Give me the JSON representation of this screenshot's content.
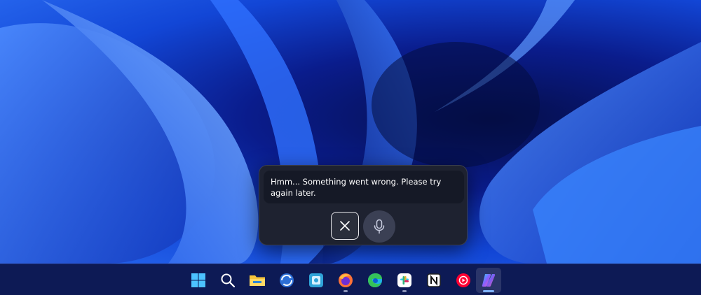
{
  "voice_panel": {
    "message": "Hmm... Something went wrong. Please try again later.",
    "dismiss_icon": "close-icon",
    "mic_icon": "microphone-icon"
  },
  "taskbar": {
    "items": [
      {
        "name": "start",
        "icon": "windows-logo-icon",
        "running": false,
        "active": false
      },
      {
        "name": "search",
        "icon": "search-icon",
        "running": false,
        "active": false
      },
      {
        "name": "file-explorer",
        "icon": "folder-icon",
        "running": false,
        "active": false
      },
      {
        "name": "sync-app",
        "icon": "sync-icon",
        "running": false,
        "active": false
      },
      {
        "name": "screenshot-tool",
        "icon": "snipping-icon",
        "running": false,
        "active": false
      },
      {
        "name": "firefox",
        "icon": "firefox-icon",
        "running": true,
        "active": false
      },
      {
        "name": "edge",
        "icon": "edge-icon",
        "running": false,
        "active": false
      },
      {
        "name": "slack",
        "icon": "slack-icon",
        "running": true,
        "active": false
      },
      {
        "name": "notion",
        "icon": "notion-icon",
        "running": false,
        "active": false
      },
      {
        "name": "youtube-music",
        "icon": "youtube-music-icon",
        "running": false,
        "active": false
      },
      {
        "name": "copilot",
        "icon": "copilot-icon",
        "running": true,
        "active": true
      }
    ]
  },
  "colors": {
    "accent": "#7fb2ff",
    "taskbar": "#0d1a55",
    "panel": "#1e2230"
  }
}
